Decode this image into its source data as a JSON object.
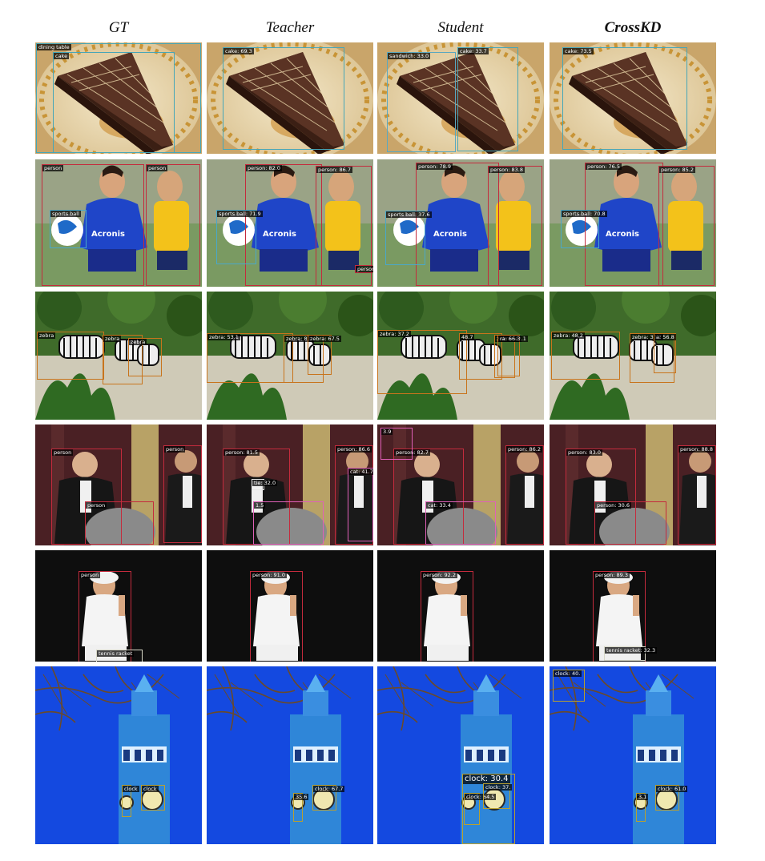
{
  "columns": [
    "GT",
    "Teacher",
    "Student",
    "CrossKD"
  ],
  "colors": {
    "cake": "#46a6b8",
    "person": "#c42b3d",
    "sports_ball": "#4aa8c8",
    "zebra": "#c8741c",
    "tie": "#e6e6e6",
    "cat": "#e060b8",
    "clock": "#b8a030",
    "tennis_racket": "#d8d8c8",
    "sandwich": "#5aa8c0",
    "dining_table": "#46a6b8"
  },
  "rows": [
    {
      "scene": "cake",
      "panels": [
        {
          "boxes": [
            {
              "label": "dining table",
              "cls": "dining_table"
            },
            {
              "label": "cake",
              "cls": "cake"
            }
          ]
        },
        {
          "boxes": [
            {
              "label": "cake: 69.3",
              "cls": "cake"
            }
          ]
        },
        {
          "boxes": [
            {
              "label": "sandwich: 33.0",
              "cls": "sandwich"
            },
            {
              "label": "cake: 33.7",
              "cls": "cake"
            }
          ]
        },
        {
          "boxes": [
            {
              "label": "cake: 73.5",
              "cls": "cake"
            }
          ]
        }
      ]
    },
    {
      "scene": "soccer",
      "panels": [
        {
          "boxes": [
            {
              "label": "person",
              "cls": "person"
            },
            {
              "label": "person",
              "cls": "person"
            },
            {
              "label": "sports ball",
              "cls": "sports_ball"
            }
          ]
        },
        {
          "boxes": [
            {
              "label": "person: 82.0",
              "cls": "person"
            },
            {
              "label": "person: 86.7",
              "cls": "person"
            },
            {
              "label": "sports ball: 71.9",
              "cls": "sports_ball"
            },
            {
              "label": "person: 3",
              "cls": "person"
            }
          ]
        },
        {
          "boxes": [
            {
              "label": "person: 78.9",
              "cls": "person"
            },
            {
              "label": "person: 83.8",
              "cls": "person"
            },
            {
              "label": "sports ball: 37.6",
              "cls": "sports_ball"
            }
          ]
        },
        {
          "boxes": [
            {
              "label": "person: 76.5",
              "cls": "person"
            },
            {
              "label": "person: 85.2",
              "cls": "person"
            },
            {
              "label": "sports ball: 70.8",
              "cls": "sports_ball"
            }
          ]
        }
      ]
    },
    {
      "scene": "zebra",
      "panels": [
        {
          "boxes": [
            {
              "label": "zebra",
              "cls": "zebra"
            },
            {
              "label": "zebra",
              "cls": "zebra"
            },
            {
              "label": "zebra",
              "cls": "zebra"
            }
          ]
        },
        {
          "boxes": [
            {
              "label": "zebra: 53.1",
              "cls": "zebra"
            },
            {
              "label": "zebra: 80.",
              "cls": "zebra"
            },
            {
              "label": "zebra: 67.5",
              "cls": "zebra"
            }
          ]
        },
        {
          "boxes": [
            {
              "label": "zebra: 37.2",
              "cls": "zebra"
            },
            {
              "label": "48.7",
              "cls": "zebra"
            },
            {
              "label": "zebra: 42.1",
              "cls": "zebra"
            },
            {
              "label": "ra: 66.3",
              "cls": "zebra"
            }
          ]
        },
        {
          "boxes": [
            {
              "label": "zebra: 48.2",
              "cls": "zebra"
            },
            {
              "label": "zebra: 30.7",
              "cls": "zebra"
            },
            {
              "label": "a: 56.8",
              "cls": "zebra"
            }
          ]
        }
      ]
    },
    {
      "scene": "people",
      "panels": [
        {
          "boxes": [
            {
              "label": "person",
              "cls": "person"
            },
            {
              "label": "person",
              "cls": "person"
            },
            {
              "label": "person",
              "cls": "person"
            }
          ]
        },
        {
          "boxes": [
            {
              "label": "person: 81.5",
              "cls": "person"
            },
            {
              "label": "person: 86.6",
              "cls": "person"
            },
            {
              "label": "tie: 32.0",
              "cls": "tie"
            },
            {
              "label": "cat: 41.7",
              "cls": "cat"
            },
            {
              "label": "1.5",
              "cls": "cat"
            }
          ]
        },
        {
          "boxes": [
            {
              "label": "person: 82.7",
              "cls": "person"
            },
            {
              "label": "person: 86.2",
              "cls": "person"
            },
            {
              "label": "cat: 33.4",
              "cls": "cat"
            },
            {
              "label": "3.9",
              "cls": "cat"
            }
          ]
        },
        {
          "boxes": [
            {
              "label": "person: 83.0",
              "cls": "person"
            },
            {
              "label": "person: 88.8",
              "cls": "person"
            },
            {
              "label": "person: 30.6",
              "cls": "person"
            }
          ]
        }
      ]
    },
    {
      "scene": "tennis",
      "panels": [
        {
          "boxes": [
            {
              "label": "person",
              "cls": "person"
            },
            {
              "label": "tennis racket",
              "cls": "tennis_racket"
            }
          ]
        },
        {
          "boxes": [
            {
              "label": "person: 91.0",
              "cls": "person"
            }
          ]
        },
        {
          "boxes": [
            {
              "label": "person: 92.2",
              "cls": "person"
            }
          ]
        },
        {
          "boxes": [
            {
              "label": "person: 89.3",
              "cls": "person"
            },
            {
              "label": "tennis racket: 32.3",
              "cls": "tennis_racket"
            }
          ]
        }
      ]
    },
    {
      "scene": "clock",
      "panels": [
        {
          "boxes": [
            {
              "label": "clock",
              "cls": "clock"
            },
            {
              "label": "clock",
              "cls": "clock"
            }
          ]
        },
        {
          "boxes": [
            {
              "label": "35.6",
              "cls": "clock"
            },
            {
              "label": "clock: 67.7",
              "cls": "clock"
            }
          ]
        },
        {
          "boxes": [
            {
              "label": "clock: 30.4",
              "cls": "clock"
            },
            {
              "label": "clock: 64.5",
              "cls": "clock"
            },
            {
              "label": "clock: 37.",
              "cls": "clock"
            }
          ]
        },
        {
          "boxes": [
            {
              "label": "3.1",
              "cls": "clock"
            },
            {
              "label": "clock: 61.0",
              "cls": "clock"
            },
            {
              "label": "clock: 40.",
              "cls": "clock"
            }
          ]
        }
      ]
    }
  ]
}
